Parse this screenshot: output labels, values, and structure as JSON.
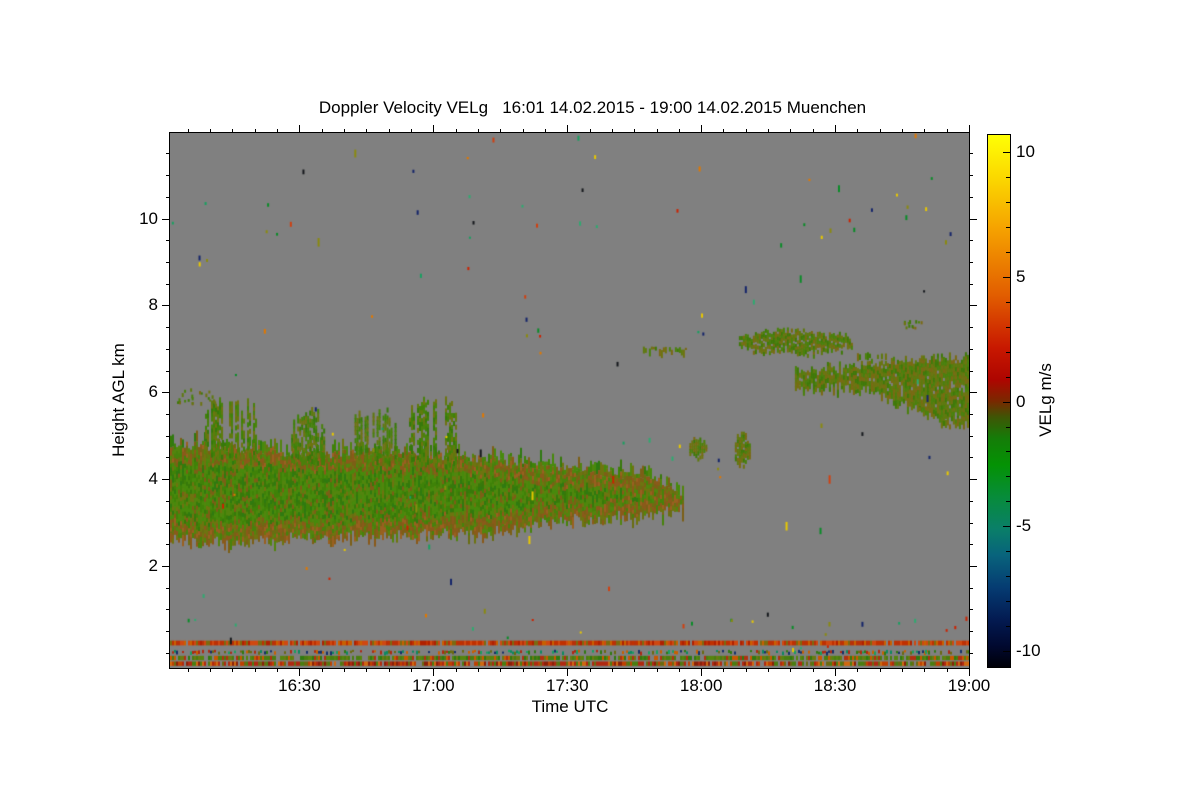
{
  "title": "Doppler Velocity VELg   16:01 14.02.2015 - 19:00 14.02.2015 Muenchen",
  "x_axis": {
    "label": "Time UTC",
    "major_ticks": [
      {
        "t": 30,
        "label": "16:30"
      },
      {
        "t": 60,
        "label": "17:00"
      },
      {
        "t": 90,
        "label": "17:30"
      },
      {
        "t": 120,
        "label": "18:00"
      },
      {
        "t": 150,
        "label": "18:30"
      },
      {
        "t": 180,
        "label": "19:00"
      }
    ],
    "minor_step_min": 5
  },
  "y_axis": {
    "label": "Height AGL km",
    "major_ticks": [
      2,
      4,
      6,
      8,
      10
    ],
    "minor_step_km": 0.5
  },
  "colorbar": {
    "label": "VELg m/s",
    "ticks": [
      10,
      5,
      0,
      -5,
      -10
    ],
    "tick_labels": [
      "10",
      "5",
      "0",
      "-5",
      "-10"
    ],
    "minor_step": 1,
    "gradient": [
      [
        "0",
        "#ffff05"
      ],
      [
        "0.08",
        "#fbd800"
      ],
      [
        "0.18",
        "#f5a000"
      ],
      [
        "0.30",
        "#e25e00"
      ],
      [
        "0.40",
        "#c81800"
      ],
      [
        "0.46",
        "#ae0500"
      ],
      [
        "0.50",
        "#7a2800"
      ],
      [
        "0.53",
        "#3f5505"
      ],
      [
        "0.57",
        "#157c08"
      ],
      [
        "0.62",
        "#049204"
      ],
      [
        "0.68",
        "#078c3a"
      ],
      [
        "0.74",
        "#0a7f68"
      ],
      [
        "0.79",
        "#08637c"
      ],
      [
        "0.85",
        "#053c72"
      ],
      [
        "0.91",
        "#031b52"
      ],
      [
        "0.96",
        "#010930"
      ],
      [
        "1",
        "#000008"
      ]
    ]
  },
  "colors": {
    "plot_bg": "#808080",
    "page_bg": "#ffffff",
    "axis": "#000000"
  },
  "chart_data": {
    "type": "heatmap",
    "title": "Doppler Velocity VELg",
    "time_start": "16:01 14.02.2015",
    "time_end": "19:00 14.02.2015",
    "site": "Muenchen",
    "xlabel": "Time UTC",
    "ylabel": "Height AGL km",
    "zlabel": "VELg m/s",
    "xlim_minutes": [
      1,
      180
    ],
    "ylim_km": [
      -0.35,
      11.97
    ],
    "zlim_ms": [
      -10.65,
      10.7
    ],
    "background_value": "no signal (gray)",
    "description": "Time-height Doppler velocity plot. A textured green/olive cloud layer (velocities near 0 to -2 m/s) extends from 16:01 to ~17:58 between ~2.7 and ~4.8 km with bumpy tops to ~5.9 km; thin olive layers near 6.8-7.4 km appear after 17:45; a layer at 6.1-6.9 km thickens toward 19:00 at the right edge; near-ground clutter stripes (red/green, ±1-5 m/s) lie below 0.3 km; sparse colored noise speckles are scattered over the gray background.",
    "features": {
      "deck": {
        "top": [
          [
            1,
            4.78
          ],
          [
            8,
            4.76
          ],
          [
            14,
            4.73
          ],
          [
            22,
            4.7
          ],
          [
            30,
            4.57
          ],
          [
            44,
            4.62
          ],
          [
            57,
            4.55
          ],
          [
            70,
            4.48
          ],
          [
            79,
            4.39
          ],
          [
            88,
            4.21
          ],
          [
            97,
            4.16
          ],
          [
            106,
            4.02
          ],
          [
            111,
            3.93
          ],
          [
            116,
            3.68
          ]
        ],
        "bottom": [
          [
            1,
            2.74
          ],
          [
            8,
            2.58
          ],
          [
            17,
            2.66
          ],
          [
            26,
            2.72
          ],
          [
            35,
            2.68
          ],
          [
            44,
            2.77
          ],
          [
            53,
            2.73
          ],
          [
            62,
            2.77
          ],
          [
            70,
            2.82
          ],
          [
            79,
            2.93
          ],
          [
            88,
            3.12
          ],
          [
            97,
            3.14
          ],
          [
            106,
            3.21
          ],
          [
            111,
            3.28
          ],
          [
            116,
            3.42
          ]
        ],
        "palette_core": [
          "#3f8208",
          "#478a0c",
          "#37790a",
          "#52850e",
          "#478a0c",
          "#3f8208",
          "#6e7410",
          "#52850e",
          "#2f7a10",
          "#7c5f16"
        ],
        "palette_edge": [
          "#6e7410",
          "#7c5f16",
          "#8a5a1a",
          "#52850e",
          "#6a6e12",
          "#8a5a1a",
          "#47820c",
          "#996020"
        ]
      },
      "bumps": [
        {
          "t": 14.4,
          "h": 5.36,
          "rt": 6.0,
          "rh": 0.52
        },
        {
          "t": 31.7,
          "h": 5.15,
          "rt": 4.0,
          "rh": 0.42
        },
        {
          "t": 46.9,
          "h": 5.2,
          "rt": 5.0,
          "rh": 0.4
        },
        {
          "t": 59.7,
          "h": 5.33,
          "rt": 5.6,
          "rh": 0.52
        }
      ],
      "bump_palette": [
        "#4a820c",
        "#5f7a0e",
        "#3f8208",
        "#6e7410",
        "#37790a"
      ],
      "feature_palette": [
        "#5f7a0e",
        "#6e7410",
        "#4a820c",
        "#3f7a08",
        "#7a6a12"
      ],
      "streaks": [
        {
          "t0": 104.7,
          "t1": 116.4,
          "h0": 6.83,
          "h1": 7.01,
          "density": 0.55
        },
        {
          "t0": 154.0,
          "t1": 162.0,
          "h0": 6.74,
          "h1": 6.9,
          "density": 0.5
        }
      ],
      "blobs": [
        {
          "t": 141.0,
          "h": 7.17,
          "rt": 13.0,
          "rh": 0.26,
          "density": 0.8
        },
        {
          "t": 119.1,
          "h": 4.72,
          "rt": 2.2,
          "rh": 0.2,
          "density": 0.9
        },
        {
          "t": 129.0,
          "h": 4.7,
          "rt": 1.9,
          "rh": 0.33,
          "density": 0.9
        }
      ],
      "band_right": {
        "top": [
          [
            141,
            6.55
          ],
          [
            153,
            6.62
          ],
          [
            164,
            6.72
          ],
          [
            180,
            6.85
          ]
        ],
        "bottom": [
          [
            141,
            6.12
          ],
          [
            153,
            6.18
          ],
          [
            160,
            6.0
          ],
          [
            166,
            5.7
          ],
          [
            172,
            5.45
          ],
          [
            180,
            5.22
          ]
        ],
        "density": 0.92
      },
      "dot_clusters": [
        {
          "t0": 1,
          "t1": 11,
          "h0": 5.75,
          "h1": 6.1,
          "n": 22
        },
        {
          "t0": 164.5,
          "t1": 169.5,
          "h0": 7.5,
          "h1": 7.68,
          "n": 12
        }
      ],
      "ground_stripes": [
        {
          "h0": 0.17,
          "h1": 0.28,
          "coverage": 0.93,
          "thin": false,
          "colors": [
            "#c03000",
            "#d04810",
            "#b02000",
            "#7a6a10",
            "#c86000",
            "#b83008",
            "#d04810",
            "#c03000"
          ]
        },
        {
          "h0": -0.02,
          "h1": 0.07,
          "coverage": 0.5,
          "thin": true,
          "colors": [
            "#0c8a60",
            "#b02810",
            "#2f7a10",
            "#14306a",
            "#c86000",
            "#6a6a10",
            "#18a060"
          ]
        },
        {
          "h0": -0.17,
          "h1": -0.07,
          "coverage": 0.88,
          "thin": false,
          "colors": [
            "#4a7d10",
            "#6a7a12",
            "#b03010",
            "#c85800",
            "#2f7a10",
            "#4a7d10",
            "#56850e"
          ]
        },
        {
          "h0": -0.3,
          "h1": -0.2,
          "coverage": 0.9,
          "thin": false,
          "colors": [
            "#b02810",
            "#c04000",
            "#4a7d10",
            "#6a6a10",
            "#d06810",
            "#b02810",
            "#8a2008"
          ]
        }
      ],
      "speckles": {
        "count": 95,
        "colors": [
          "#e07800",
          "#cc2200",
          "#e8c800",
          "#18a060",
          "#0a8c28",
          "#14246a",
          "#15181c",
          "#8a8a10",
          "#d04010",
          "#2faa70"
        ],
        "bands": [
          {
            "n": 16,
            "h0": 9.55,
            "h1": 10.45
          },
          {
            "n": 22,
            "h0": 0.45,
            "h1": 0.95
          }
        ]
      }
    }
  }
}
